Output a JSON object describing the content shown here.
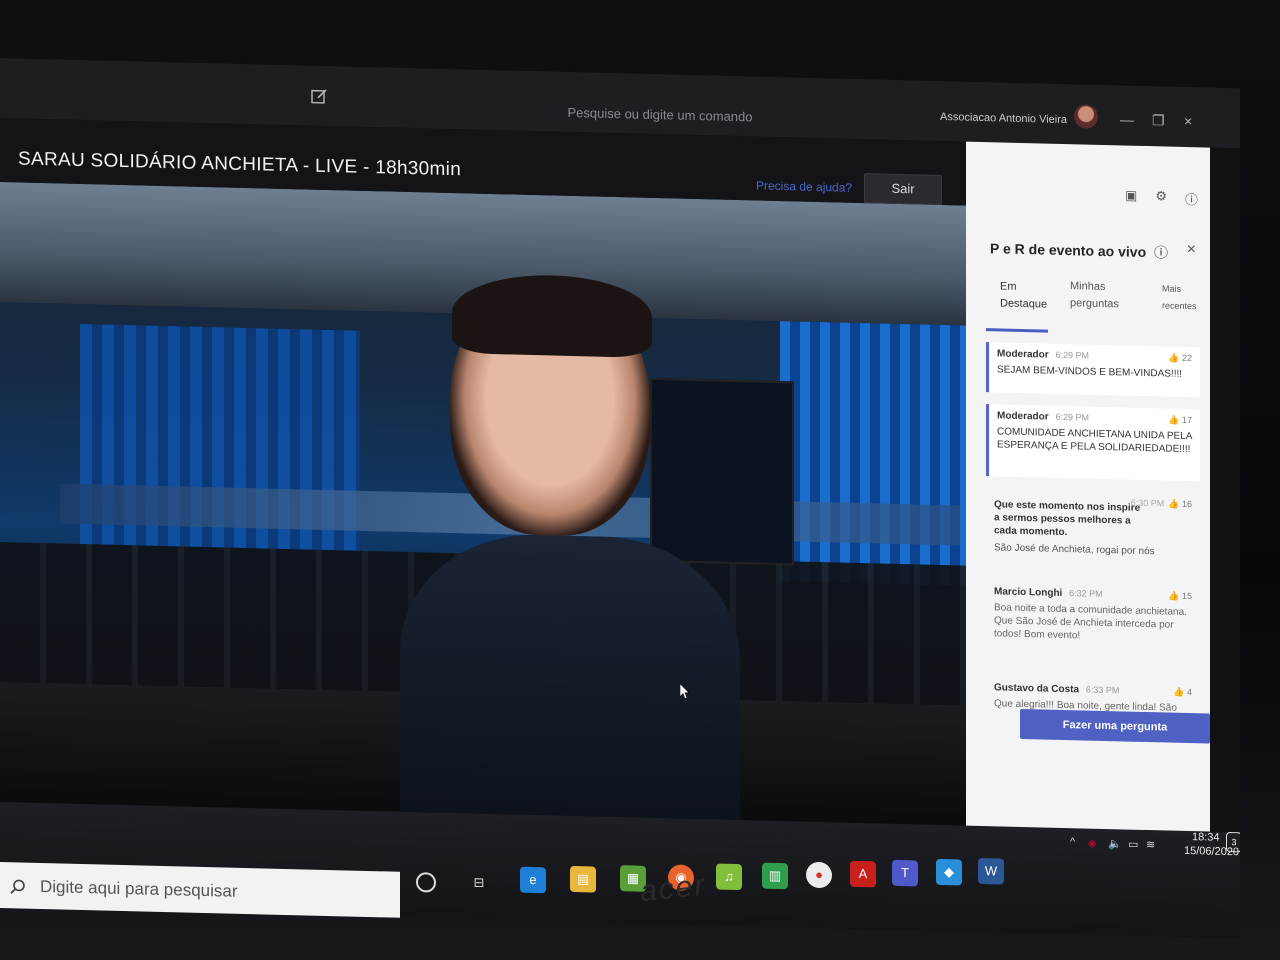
{
  "window": {
    "search_placeholder": "Pesquise ou digite um comando",
    "account_name": "Associacao Antonio Vieira",
    "minimize": "—",
    "maximize": "❐",
    "close": "×"
  },
  "meeting": {
    "title": "SARAU SOLIDÁRIO ANCHIETA - LIVE - 18h30min",
    "help_link": "Precisa de ajuda?",
    "leave_label": "Sair"
  },
  "qa_panel": {
    "title": "P e R de evento ao vivo",
    "info_icon": "ⓘ",
    "close_icon": "×",
    "tabs": [
      {
        "label_line1": "Em",
        "label_line2": "Destaque"
      },
      {
        "label_line1": "Minhas",
        "label_line2": "perguntas"
      },
      {
        "label_line1": "Mais",
        "label_line2": "recentes"
      }
    ],
    "questions": [
      {
        "author": "Moderador",
        "time": "6:29 PM",
        "likes": "22",
        "text": "SEJAM BEM-VINDOS E BEM-VINDAS!!!!",
        "sub": ""
      },
      {
        "author": "Moderador",
        "time": "6:29 PM",
        "likes": "17",
        "text": "COMUNIDADE ANCHIETANA UNIDA PELA ESPERANÇA E PELA SOLIDARIEDADE!!!!",
        "sub": ""
      },
      {
        "author": "",
        "time": "6:30 PM",
        "likes": "16",
        "text": "Que este momento nos inspire a sermos pessos melhores a cada momento.",
        "sub": "São José de Anchieta, rogai por nós"
      },
      {
        "author": "Marcio Longhi",
        "time": "6:32 PM",
        "likes": "15",
        "text": "Boa noite a toda a comunidade anchietana. Que São José de Anchieta interceda por todos! Bom evento!",
        "sub": ""
      },
      {
        "author": "Gustavo da Costa",
        "time": "6:33 PM",
        "likes": "4",
        "text": "Que alegria!!! Boa noite, gente linda! São",
        "sub": ""
      }
    ],
    "ask_button": "Fazer uma pergunta"
  },
  "taskbar": {
    "search_placeholder": "Digite aqui para pesquisar",
    "clock_time": "18:34",
    "clock_date": "15/06/2020",
    "notification_count": "3"
  },
  "bezel": {
    "brand": "acer"
  },
  "colors": {
    "accent": "#4f62c4",
    "panel_bg": "#f4f4f6",
    "titlebar_bg": "#1d1d22"
  }
}
